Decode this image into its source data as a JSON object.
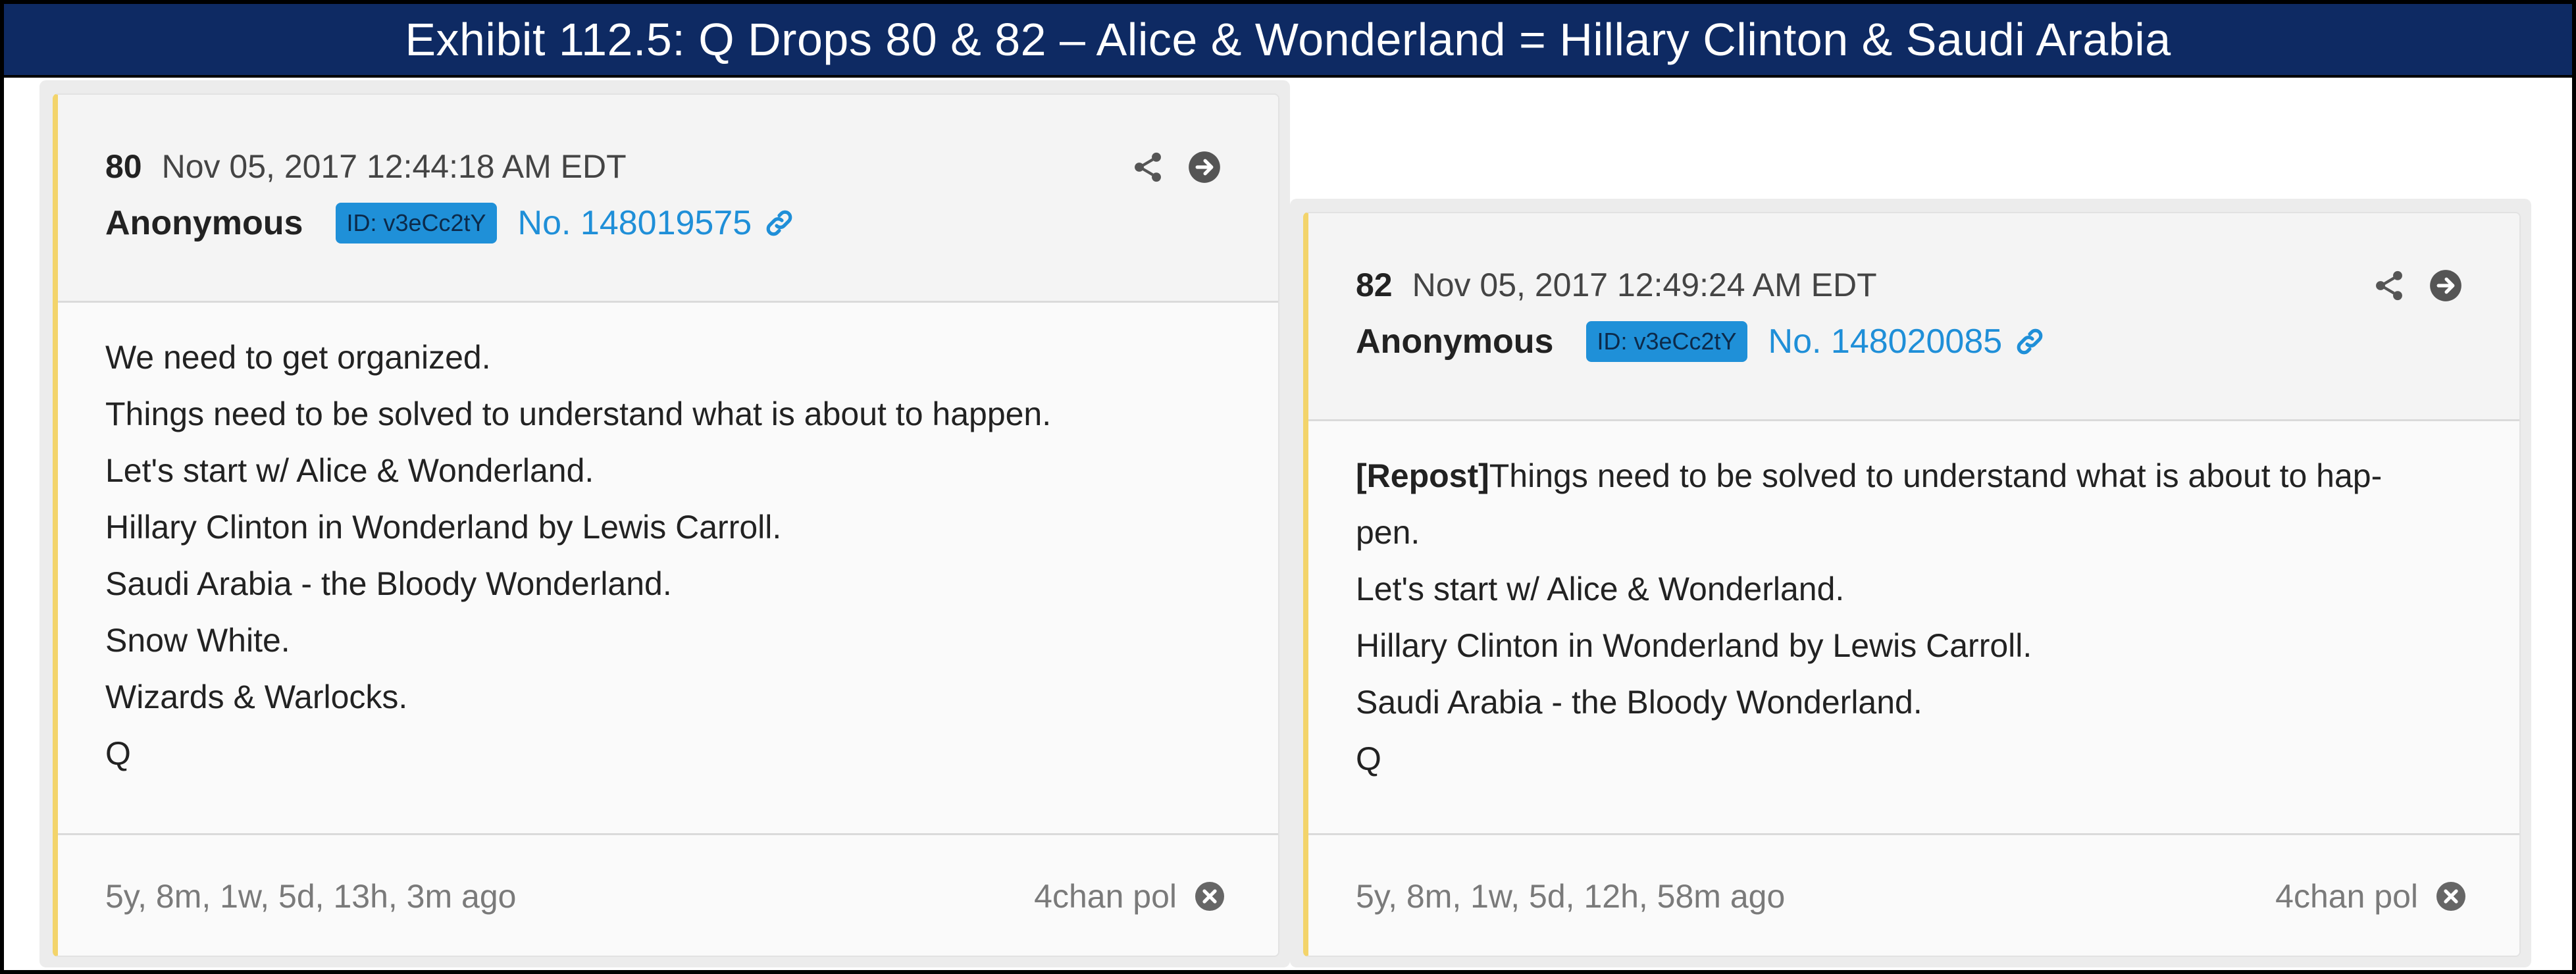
{
  "exhibit_title": "Exhibit 112.5: Q Drops 80 & 82 – Alice & Wonderland = Hillary Clinton & Saudi Arabia",
  "colors": {
    "title_bar": "#0e2a63",
    "accent_border": "#f3d46b",
    "link": "#1f8fd8",
    "badge": "#1f90d8"
  },
  "posts": [
    {
      "number": "80",
      "date": "Nov 05, 2017 12:44:18 AM EDT",
      "author": "Anonymous",
      "id_badge": "ID: v3eCc2tY",
      "post_link": "No. 148019575",
      "lines": [
        "We need to get organized.",
        "Things need to be solved to understand what is about to happen.",
        "Let's start w/ Alice & Wonderland.",
        "Hillary Clinton in Wonderland by Lewis Carroll.",
        "Saudi Arabia - the Bloody Wonderland.",
        "Snow White.",
        "Wizards & Warlocks.",
        "Q"
      ],
      "age": "5y, 8m, 1w, 5d, 13h, 3m ago",
      "source": "4chan pol",
      "icons": [
        "share-icon",
        "arrow-right-circle-icon",
        "link-icon",
        "close-circle-icon"
      ]
    },
    {
      "number": "82",
      "date": "Nov 05, 2017 12:49:24 AM EDT",
      "author": "Anonymous",
      "id_badge": "ID: v3eCc2tY",
      "post_link": "No. 148020085",
      "repost_tag": "[Repost]",
      "lines": [
        "Things need to be solved to understand what is about to hap-",
        "pen.",
        "Let's start w/ Alice & Wonderland.",
        "Hillary Clinton in Wonderland by Lewis Carroll.",
        "Saudi Arabia - the Bloody Wonderland.",
        "Q"
      ],
      "age": "5y, 8m, 1w, 5d, 12h, 58m ago",
      "source": "4chan pol",
      "icons": [
        "share-icon",
        "arrow-right-circle-icon",
        "link-icon",
        "close-circle-icon"
      ]
    }
  ]
}
